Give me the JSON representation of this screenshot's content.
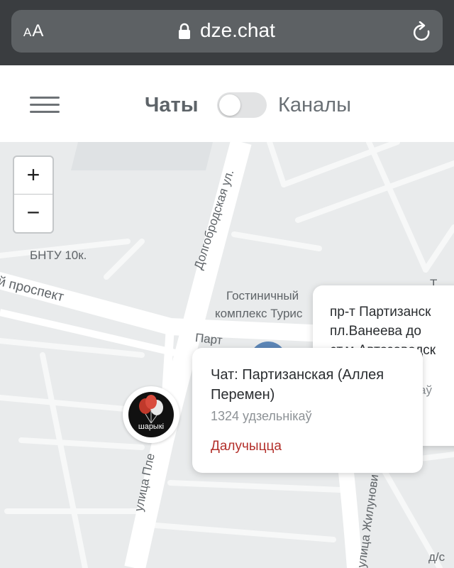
{
  "browser": {
    "text_size_small": "A",
    "text_size_large": "A",
    "url": "dze.chat"
  },
  "header": {
    "chats_label": "Чаты",
    "channels_label": "Каналы",
    "toggle_on": false
  },
  "map": {
    "zoom_in": "+",
    "zoom_out": "−",
    "labels": {
      "bntu": "БНТУ 10к.",
      "prospekt": "й проспект",
      "dolgobrodskaya": "Долгобродская ул.",
      "hotel_line1": "Гостиничный",
      "hotel_line2": "комплекс Турис",
      "partizan_street": "Парт",
      "plekhanova": "улица Пле",
      "zhilunovicha": "улица Жилунови",
      "right_top": "Т",
      "bottom_right": "д/с"
    }
  },
  "marker": {
    "label": "шарыкі"
  },
  "cards": {
    "back": {
      "lines": [
        "пр-т Партизанск",
        "пл.Ванеева до",
        "ст.м.Автозаводск"
      ],
      "partial": "аў"
    },
    "front": {
      "title": "Чат: Партизанская (Аллея Перемен)",
      "members": "1324 удзельнікаў",
      "join": "Далучыцца"
    }
  },
  "colors": {
    "join_accent": "#b3302b",
    "map_bg": "#e9ebec",
    "road": "#ffffff"
  }
}
